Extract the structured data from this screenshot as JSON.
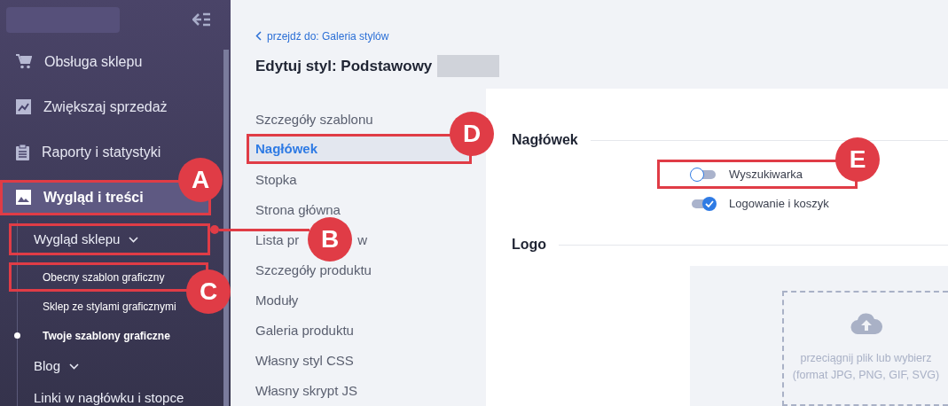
{
  "sidebar": {
    "items": [
      {
        "label": "Obsługa sklepu",
        "selected": false
      },
      {
        "label": "Zwiększaj sprzedaż",
        "selected": false
      },
      {
        "label": "Raporty i statystyki",
        "selected": false
      },
      {
        "label": "Wygląd i treści",
        "selected": true,
        "callout": {
          "label": "A",
          "kind": "corner_top"
        },
        "children": [
          {
            "label": "Wygląd sklepu",
            "kind": "group",
            "expanded": true,
            "callout": {
              "label": "B",
              "kind": "leader"
            },
            "children": [
              {
                "label": "Obecny szablon graficzny",
                "selected": false,
                "callout": {
                  "label": "C",
                  "kind": "corner_bottom"
                }
              },
              {
                "label": "Sklep ze stylami graficznymi",
                "selected": false
              },
              {
                "label": "Twoje szablony graficzne",
                "selected": true
              }
            ]
          },
          {
            "label": "Blog",
            "kind": "group"
          },
          {
            "label": "Linki w nagłówku i stopce",
            "kind": "link"
          }
        ]
      }
    ]
  },
  "breadcrumb": "przejdź do: Galeria stylów",
  "title": "Edytuj styl: Podstawowy",
  "style_nav": [
    {
      "label": "Szczegóły szablonu",
      "selected": false
    },
    {
      "label": "Nagłówek",
      "selected": true,
      "callout": {
        "label": "D",
        "kind": "corner_top"
      }
    },
    {
      "label": "Stopka",
      "selected": false
    },
    {
      "label": "Strona główna",
      "selected": false
    },
    {
      "label": "Lista pr",
      "label_end": "w",
      "selected": false
    },
    {
      "label": "Szczegóły produktu",
      "selected": false
    },
    {
      "label": "Moduły",
      "selected": false
    },
    {
      "label": "Galeria produktu",
      "selected": false
    },
    {
      "label": "Własny styl CSS",
      "selected": false
    },
    {
      "label": "Własny skrypt JS",
      "selected": false
    }
  ],
  "sections": [
    {
      "title": "Nagłówek",
      "toggles": [
        {
          "label": "Wyszukiwarka",
          "on": false,
          "callout": {
            "label": "E",
            "kind": "corner_top"
          }
        },
        {
          "label": "Logowanie i koszyk",
          "on": true
        }
      ]
    },
    {
      "title": "Logo",
      "upload": {
        "line_1": "przeciągnij plik lub wybierz",
        "line_2": "(format JPG, PNG, GIF, SVG)"
      }
    }
  ]
}
